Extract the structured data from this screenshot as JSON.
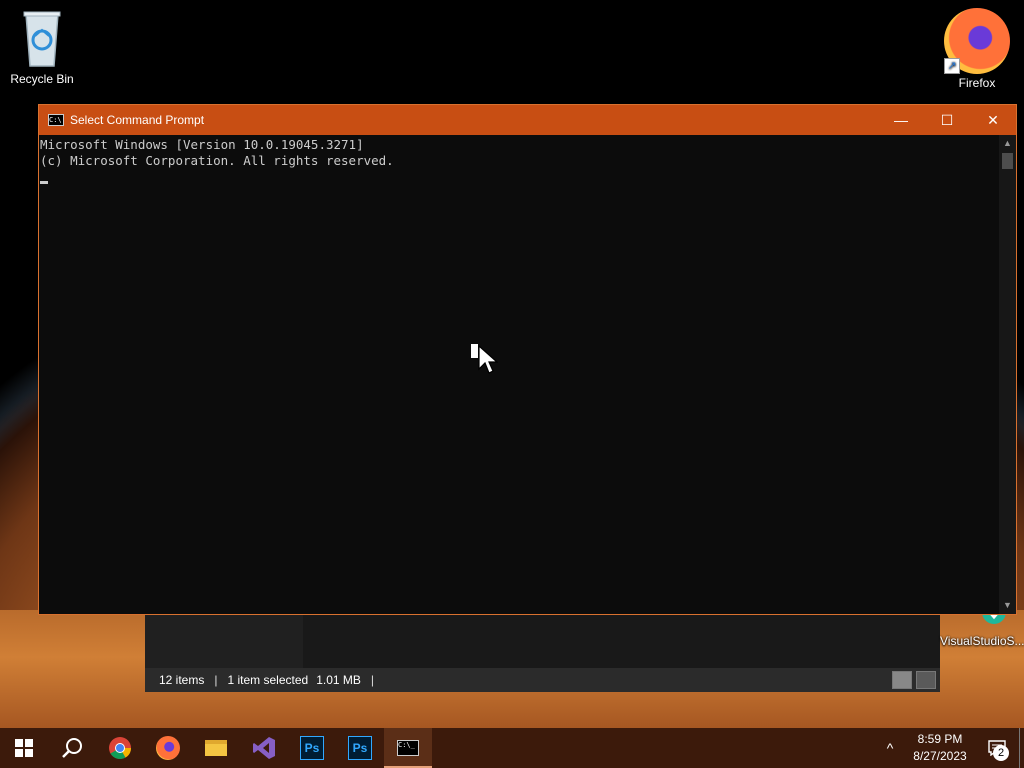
{
  "desktop": {
    "icons": [
      {
        "label": "Recycle Bin"
      },
      {
        "label": "Firefox"
      },
      {
        "label": "VisualStudioS..."
      }
    ]
  },
  "explorer": {
    "status": {
      "items": "12 items",
      "selected": "1 item selected",
      "size": "1.01 MB",
      "sep": "|"
    }
  },
  "cmd": {
    "title": "Select Command Prompt",
    "buttons": {
      "minimize": "—",
      "maximize": "☐",
      "close": "✕"
    },
    "lines": [
      "Microsoft Windows [Version 10.0.19045.3271]",
      "(c) Microsoft Corporation. All rights reserved."
    ]
  },
  "taskbar": {
    "items": [
      "start-icon",
      "search-icon",
      "chrome-icon",
      "firefox-icon",
      "file-explorer-icon",
      "visual-studio-icon",
      "photoshop-icon",
      "photoshop-icon",
      "command-prompt-icon"
    ],
    "ps_label": "Ps",
    "tray": {
      "chevron": "^",
      "time": "8:59 PM",
      "date": "8/27/2023",
      "notifications": "2"
    }
  },
  "colors": {
    "cmd_titlebar": "#c84e13",
    "taskbar": "#3c1a0b"
  }
}
